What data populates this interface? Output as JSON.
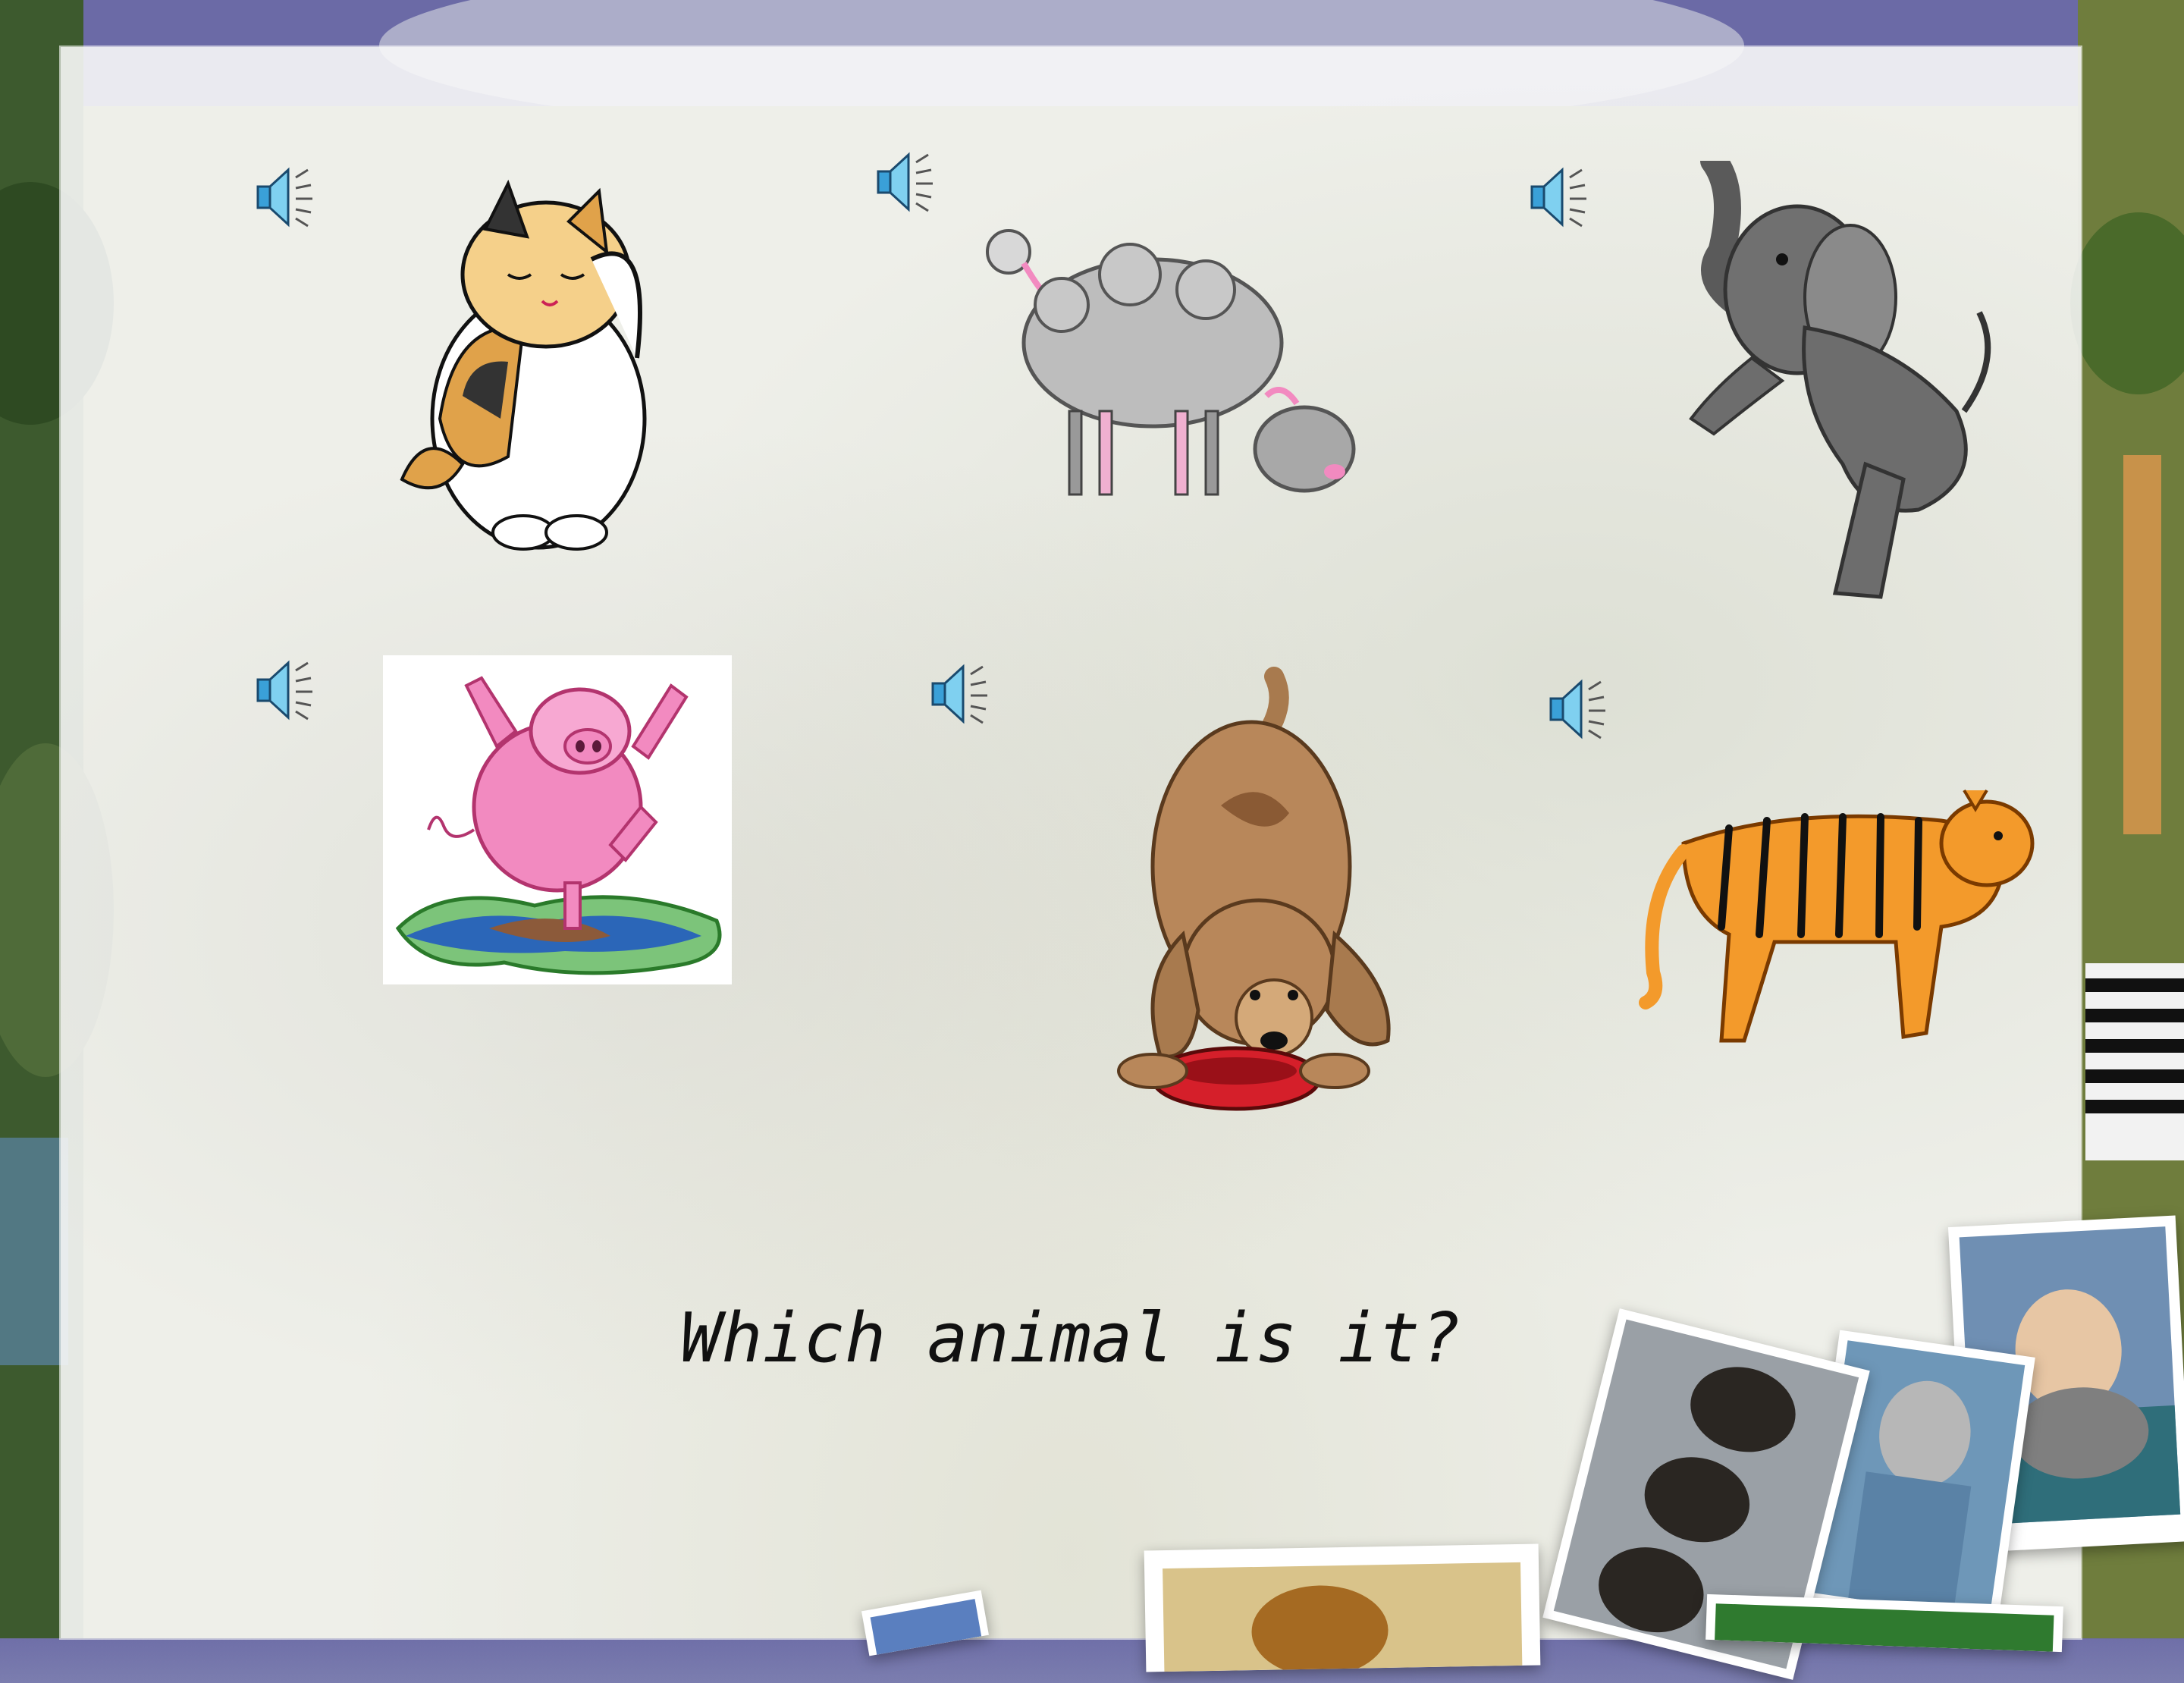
{
  "slide": {
    "question": "Which animal is it?"
  },
  "icons": {
    "speaker": "speaker-sound-icon"
  },
  "animals": [
    {
      "name": "cat",
      "sound_icon": "speaker-sound-icon"
    },
    {
      "name": "sheep",
      "sound_icon": "speaker-sound-icon"
    },
    {
      "name": "elephant",
      "sound_icon": "speaker-sound-icon"
    },
    {
      "name": "pig",
      "sound_icon": "speaker-sound-icon"
    },
    {
      "name": "dog",
      "sound_icon": "speaker-sound-icon"
    },
    {
      "name": "tiger",
      "sound_icon": "speaker-sound-icon"
    }
  ],
  "colors": {
    "slide_bg": "#f8f8f8",
    "speaker_blue": "#3aa0d8",
    "cat_orange": "#e0a24a",
    "pig_pink": "#f28ac0",
    "dog_brown": "#a87a4e",
    "tiger_orange": "#f39a2b",
    "elephant_gray": "#6d6d6d",
    "sheep_gray": "#b8b8b8"
  }
}
